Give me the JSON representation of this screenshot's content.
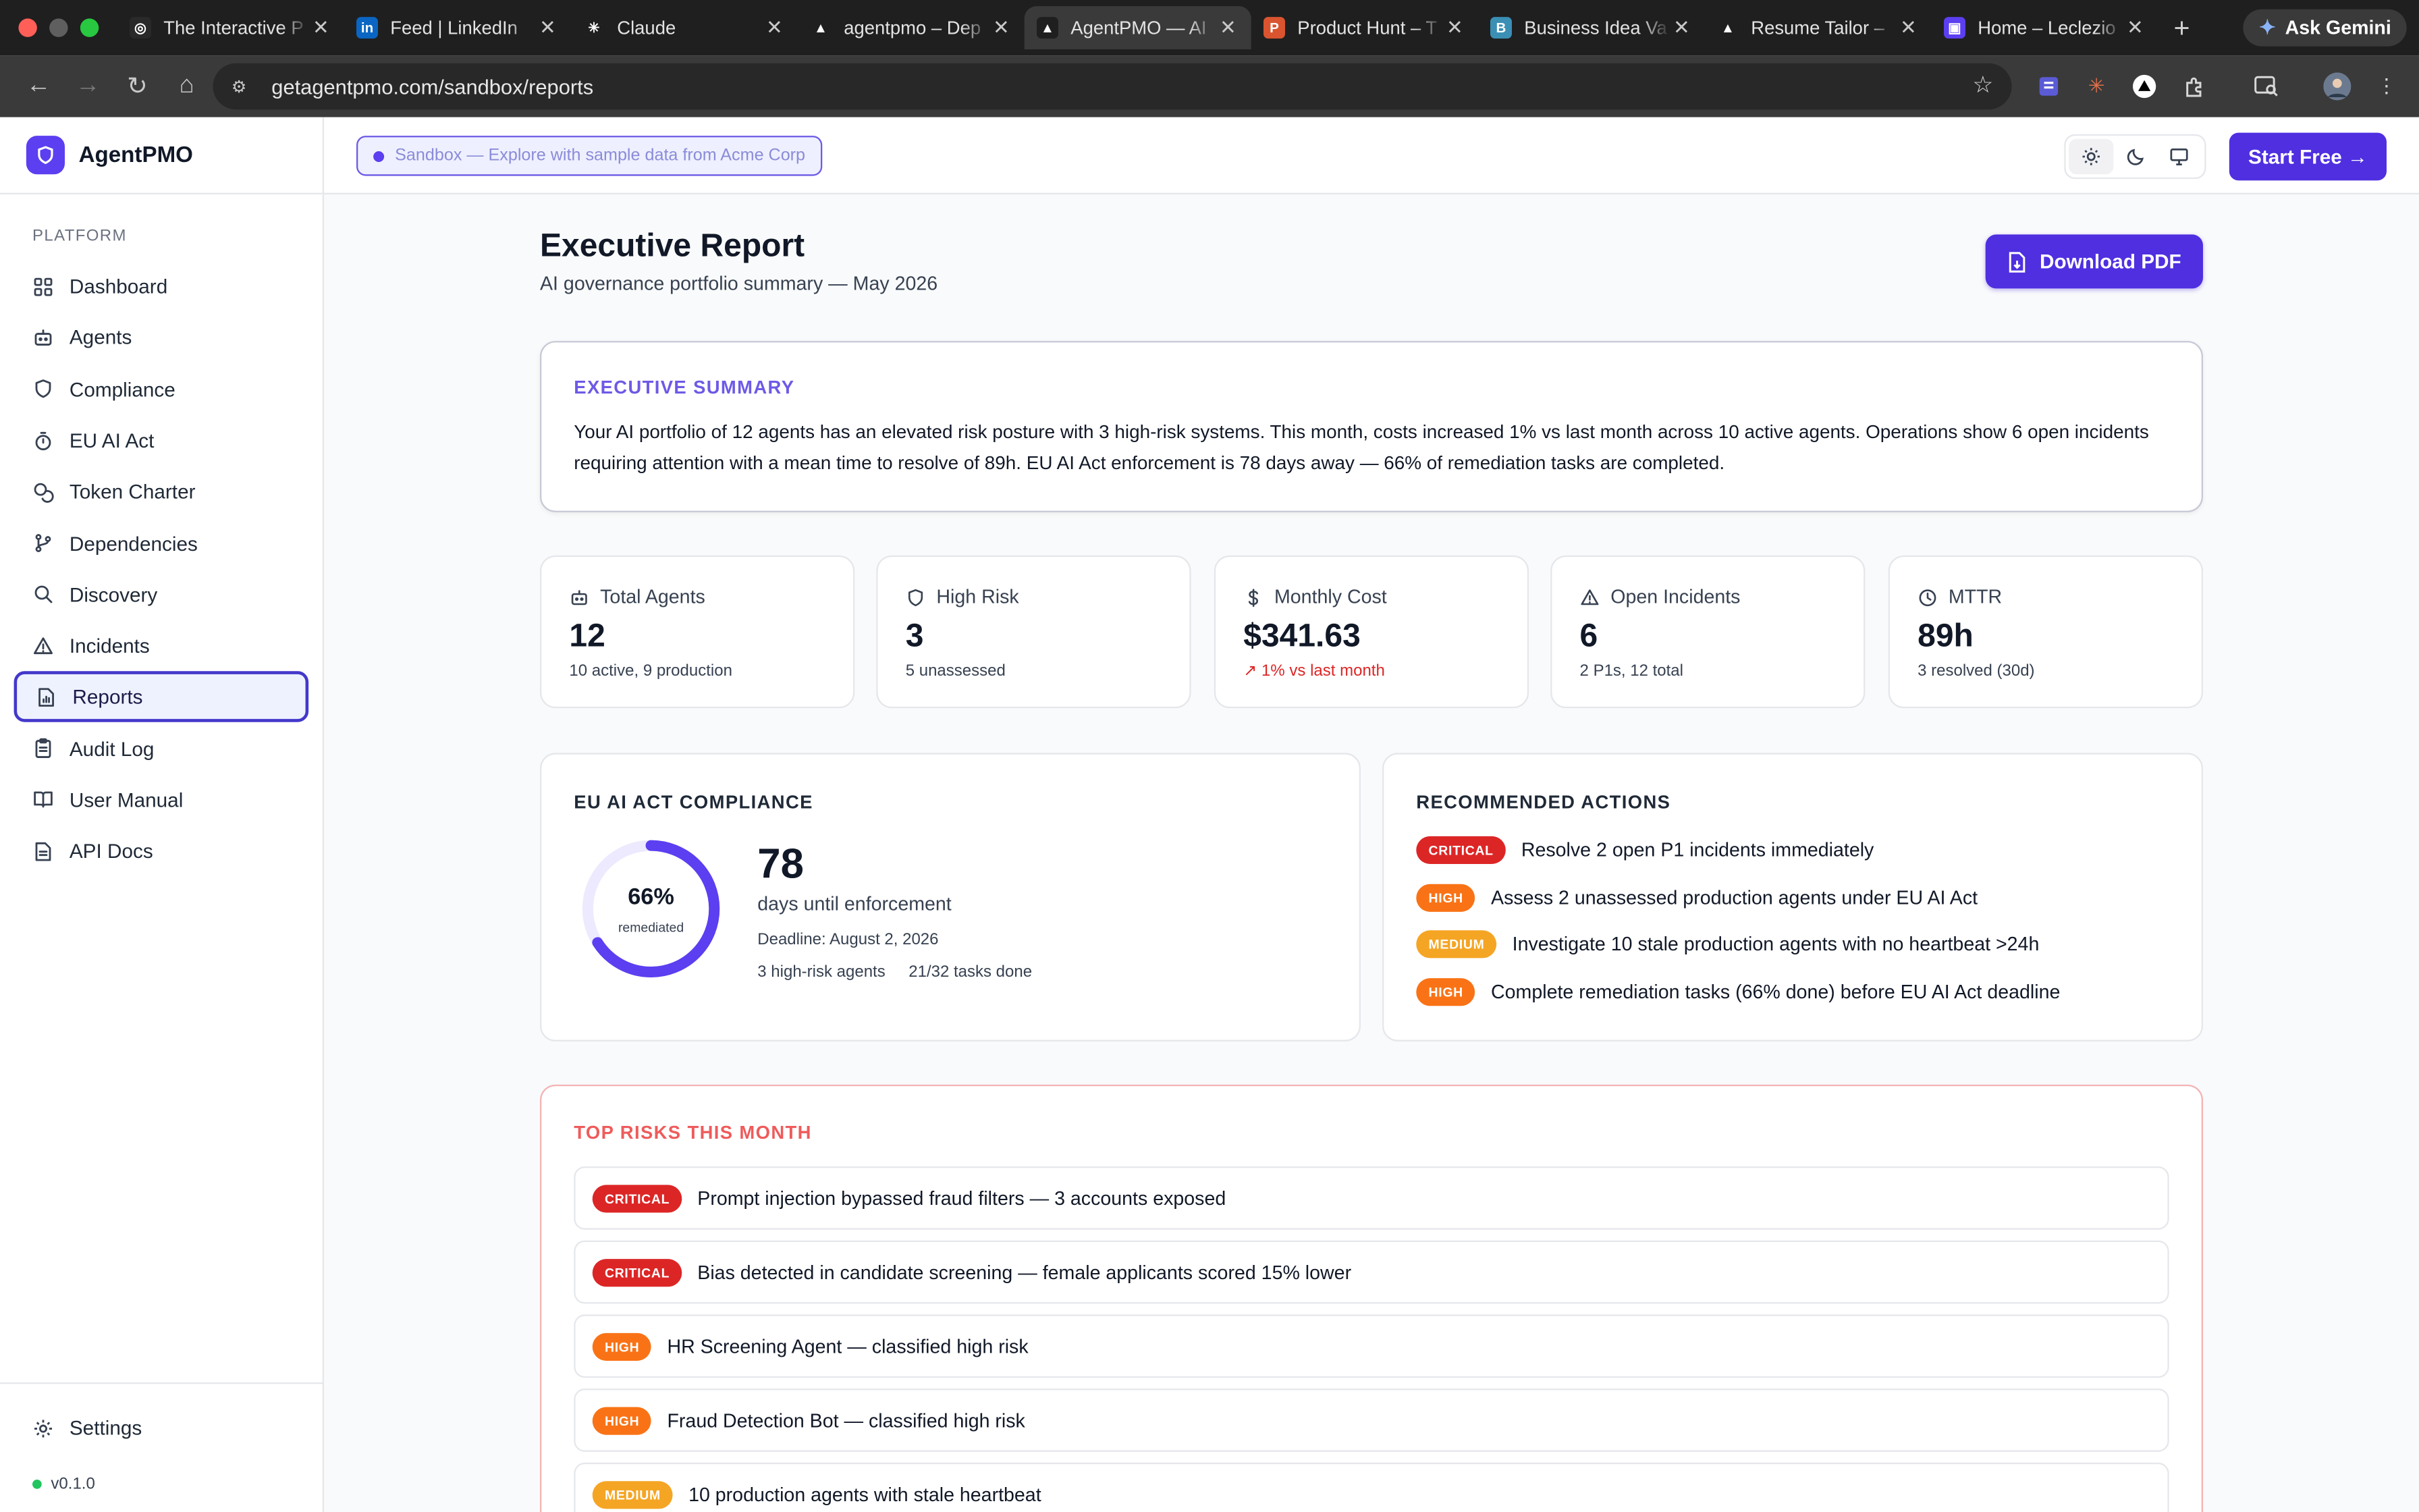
{
  "browser": {
    "tabs": [
      {
        "title": "The Interactive P",
        "fav": "◎",
        "fav_color": "#2a2a2a"
      },
      {
        "title": "Feed | LinkedIn",
        "fav": "in",
        "fav_color": "#0a66c2"
      },
      {
        "title": "Claude",
        "fav": "✳",
        "fav_color": "#1f1f1f"
      },
      {
        "title": "agentpmo – Dep",
        "fav": "▲",
        "fav_color": "#1f1f1f"
      },
      {
        "title": "AgentPMO — AI",
        "fav": "▲",
        "fav_color": "#1f1f1f"
      },
      {
        "title": "Product Hunt – T",
        "fav": "P",
        "fav_color": "#da552f"
      },
      {
        "title": "Business Idea Va",
        "fav": "B",
        "fav_color": "#3b8fb5"
      },
      {
        "title": "Resume Tailor –",
        "fav": "▲",
        "fav_color": "#1f1f1f"
      },
      {
        "title": "Home – Leclezio",
        "fav": "▣",
        "fav_color": "#5b3ff0"
      }
    ],
    "active_tab": 4,
    "ask_gemini": "Ask Gemini",
    "url": "getagentpmo.com/sandbox/reports"
  },
  "brand": {
    "name": "AgentPMO"
  },
  "sidebar": {
    "section": "PLATFORM",
    "items": [
      {
        "label": "Dashboard",
        "icon": "grid-icon"
      },
      {
        "label": "Agents",
        "icon": "bot-icon"
      },
      {
        "label": "Compliance",
        "icon": "shield-icon"
      },
      {
        "label": "EU AI Act",
        "icon": "timer-icon"
      },
      {
        "label": "Token Charter",
        "icon": "coins-icon"
      },
      {
        "label": "Dependencies",
        "icon": "git-branch-icon"
      },
      {
        "label": "Discovery",
        "icon": "search-icon"
      },
      {
        "label": "Incidents",
        "icon": "warning-icon"
      },
      {
        "label": "Reports",
        "icon": "report-icon",
        "active": true
      },
      {
        "label": "Audit Log",
        "icon": "clipboard-icon"
      },
      {
        "label": "User Manual",
        "icon": "book-icon"
      },
      {
        "label": "API Docs",
        "icon": "file-icon"
      }
    ],
    "settings": "Settings",
    "version": "v0.1.0"
  },
  "topbar": {
    "sandbox": "Sandbox — Explore with sample data from Acme Corp",
    "start_free": "Start Free →"
  },
  "page": {
    "title": "Executive Report",
    "subtitle": "AI governance portfolio summary — May 2026",
    "download": "Download PDF"
  },
  "summary": {
    "heading": "EXECUTIVE SUMMARY",
    "text": "Your AI portfolio of 12 agents has an elevated risk posture with 3 high-risk systems. This month, costs increased 1% vs last month across 10 active agents. Operations show 6 open incidents requiring attention with a mean time to resolve of 89h. EU AI Act enforcement is 78 days away — 66% of remediation tasks are completed."
  },
  "kpis": [
    {
      "label": "Total Agents",
      "value": "12",
      "sub": "10 active, 9 production",
      "icon": "bot-icon"
    },
    {
      "label": "High Risk",
      "value": "3",
      "sub": "5 unassessed",
      "icon": "shield-icon"
    },
    {
      "label": "Monthly Cost",
      "value": "$341.63",
      "sub": "1% vs last month",
      "icon": "dollar-icon",
      "sub_color": "#dc2626"
    },
    {
      "label": "Open Incidents",
      "value": "6",
      "sub": "2 P1s, 12 total",
      "icon": "warning-icon"
    },
    {
      "label": "MTTR",
      "value": "89h",
      "sub": "3 resolved (30d)",
      "icon": "clock-icon"
    }
  ],
  "eu": {
    "heading": "EU AI ACT COMPLIANCE",
    "percent": 66,
    "percent_label": "66%",
    "remediated": "remediated",
    "days": "78",
    "days_label": "days until enforcement",
    "deadline": "Deadline: August 2, 2026",
    "high_risk": "3 high-risk agents",
    "tasks": "21/32 tasks done",
    "ring_color": "#5b3ff0"
  },
  "recommended": {
    "heading": "RECOMMENDED ACTIONS",
    "items": [
      {
        "severity": "CRITICAL",
        "level": "critical",
        "text": "Resolve 2 open P1 incidents immediately"
      },
      {
        "severity": "HIGH",
        "level": "high",
        "text": "Assess 2 unassessed production agents under EU AI Act"
      },
      {
        "severity": "MEDIUM",
        "level": "medium",
        "text": "Investigate 10 stale production agents with no heartbeat >24h"
      },
      {
        "severity": "HIGH",
        "level": "high",
        "text": "Complete remediation tasks (66% done) before EU AI Act deadline"
      }
    ]
  },
  "risks": {
    "heading": "TOP RISKS THIS MONTH",
    "items": [
      {
        "severity": "CRITICAL",
        "level": "critical",
        "text": "Prompt injection bypassed fraud filters — 3 accounts exposed"
      },
      {
        "severity": "CRITICAL",
        "level": "critical",
        "text": "Bias detected in candidate screening — female applicants scored 15% lower"
      },
      {
        "severity": "HIGH",
        "level": "high",
        "text": "HR Screening Agent — classified high risk"
      },
      {
        "severity": "HIGH",
        "level": "high",
        "text": "Fraud Detection Bot — classified high risk"
      },
      {
        "severity": "MEDIUM",
        "level": "medium",
        "text": "10 production agents with stale heartbeat"
      }
    ]
  }
}
